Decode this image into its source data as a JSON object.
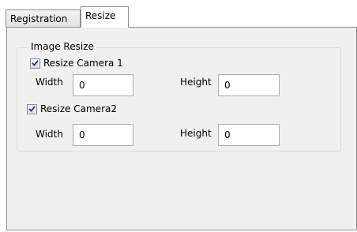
{
  "tabs": [
    {
      "label": "Registration",
      "active": false
    },
    {
      "label": "Resize",
      "active": true
    }
  ],
  "image_resize": {
    "group_title": "Image Resize",
    "camera1": {
      "checkbox_label": "Resize Camera 1",
      "checked": true,
      "width_label": "Width",
      "width_value": "0",
      "height_label": "Height",
      "height_value": "0"
    },
    "camera2": {
      "checkbox_label": "Resize Camera2",
      "checked": true,
      "width_label": "Width",
      "width_value": "0",
      "height_label": "Height",
      "height_value": "0"
    }
  },
  "colors": {
    "panel_background": "#f0f0f0",
    "check_mark": "#1f3a7a",
    "border": "#8e8f8f"
  }
}
